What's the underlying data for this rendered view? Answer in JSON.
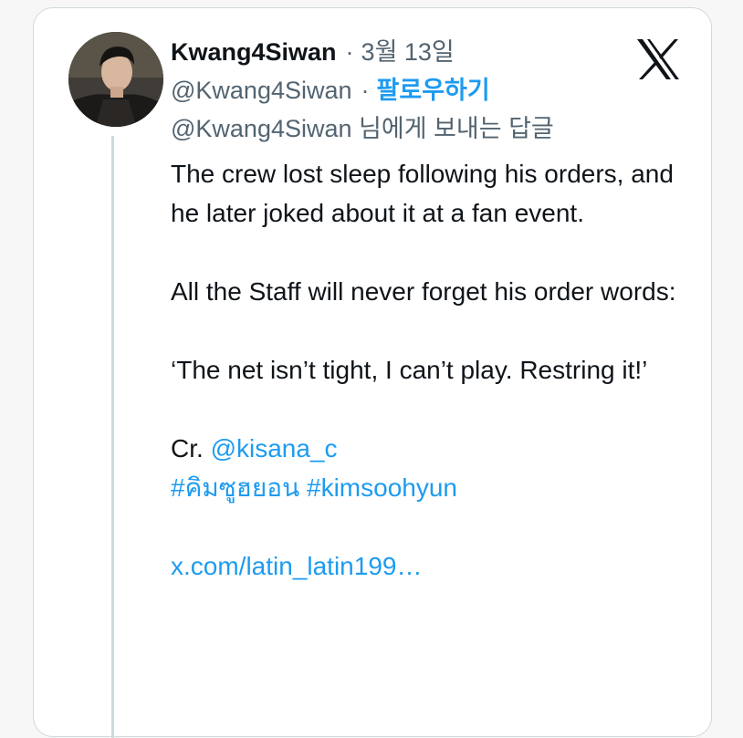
{
  "tweet": {
    "display_name": "Kwang4Siwan",
    "separator": "·",
    "date": "3월 13일",
    "handle": "@Kwang4Siwan",
    "follow_label": "팔로우하기",
    "reply_to": "@Kwang4Siwan 님에게 보내는 답글",
    "paragraphs": [
      "The crew lost sleep following his orders, and he later joked about it at a fan event.",
      "All the Staff will never forget his order words:",
      "‘The net isn’t tight, I can’t play. Restring it!’"
    ],
    "credit_prefix": "Cr.",
    "credit_mention": "@kisana_c",
    "hashtag_1": "#คิมซูฮยอน",
    "hashtag_2": "#kimsoohyun",
    "link_text": "x.com/latin_latin199…"
  },
  "icons": {
    "platform_logo": "x-logo-icon",
    "avatar": "profile-avatar"
  },
  "colors": {
    "link": "#1d9bf0",
    "text": "#0f1419",
    "muted": "#536471",
    "border": "#cfd9de"
  }
}
